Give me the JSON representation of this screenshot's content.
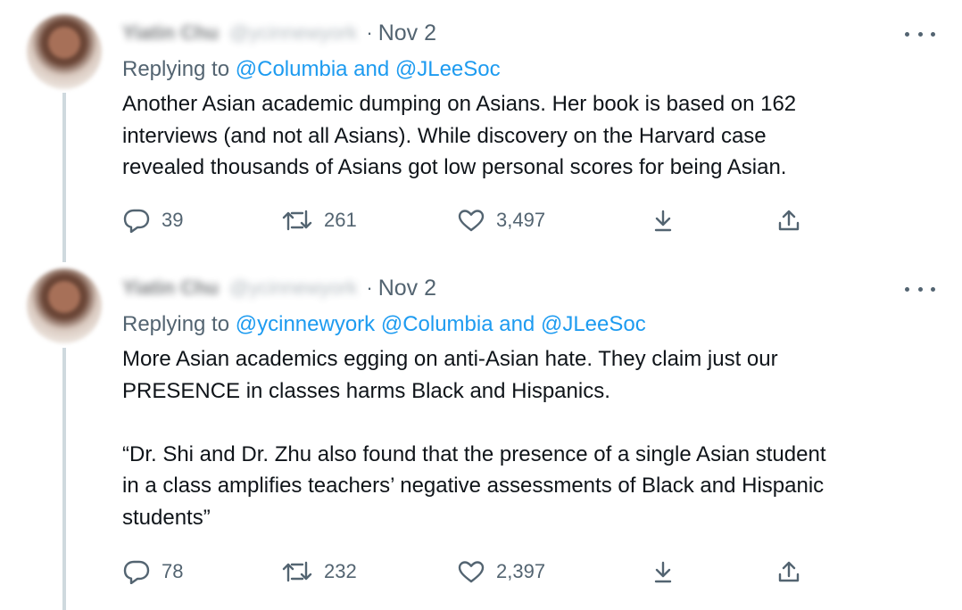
{
  "tweets": [
    {
      "author_name": "Yiatin Chu",
      "author_handle": "@ycinnewyork",
      "date": "Nov 2",
      "replying_prefix": "Replying to",
      "replying_to": "@Columbia and @JLeeSoc",
      "text": [
        "Another Asian academic dumping on Asians. Her book is based on 162",
        "interviews (and not all Asians). While discovery on the Harvard case",
        "revealed thousands of Asians got low personal scores for being Asian."
      ],
      "replies": "39",
      "retweets": "261",
      "likes": "3,497"
    },
    {
      "author_name": "Yiatin Chu",
      "author_handle": "@ycinnewyork",
      "date": "Nov 2",
      "replying_prefix": "Replying to",
      "replying_to": "@ycinnewyork @Columbia and @JLeeSoc",
      "text_p1": [
        "More Asian academics egging on anti-Asian hate. They claim just our",
        "PRESENCE in classes harms Black and Hispanics."
      ],
      "text_p2": [
        "“Dr. Shi and Dr. Zhu also found that the presence of a single Asian student",
        "in a class amplifies teachers’ negative assessments of Black and Hispanic",
        "students”"
      ],
      "replies": "78",
      "retweets": "232",
      "likes": "2,397"
    }
  ],
  "icons": {
    "more": "more-icon",
    "reply": "reply-icon",
    "retweet": "retweet-icon",
    "like": "like-icon",
    "bookmark": "bookmark-icon",
    "share": "share-icon"
  },
  "colors": {
    "link": "#1d9bf0",
    "secondary": "#536471",
    "text": "#0f1419",
    "thread": "#cfd9de"
  }
}
